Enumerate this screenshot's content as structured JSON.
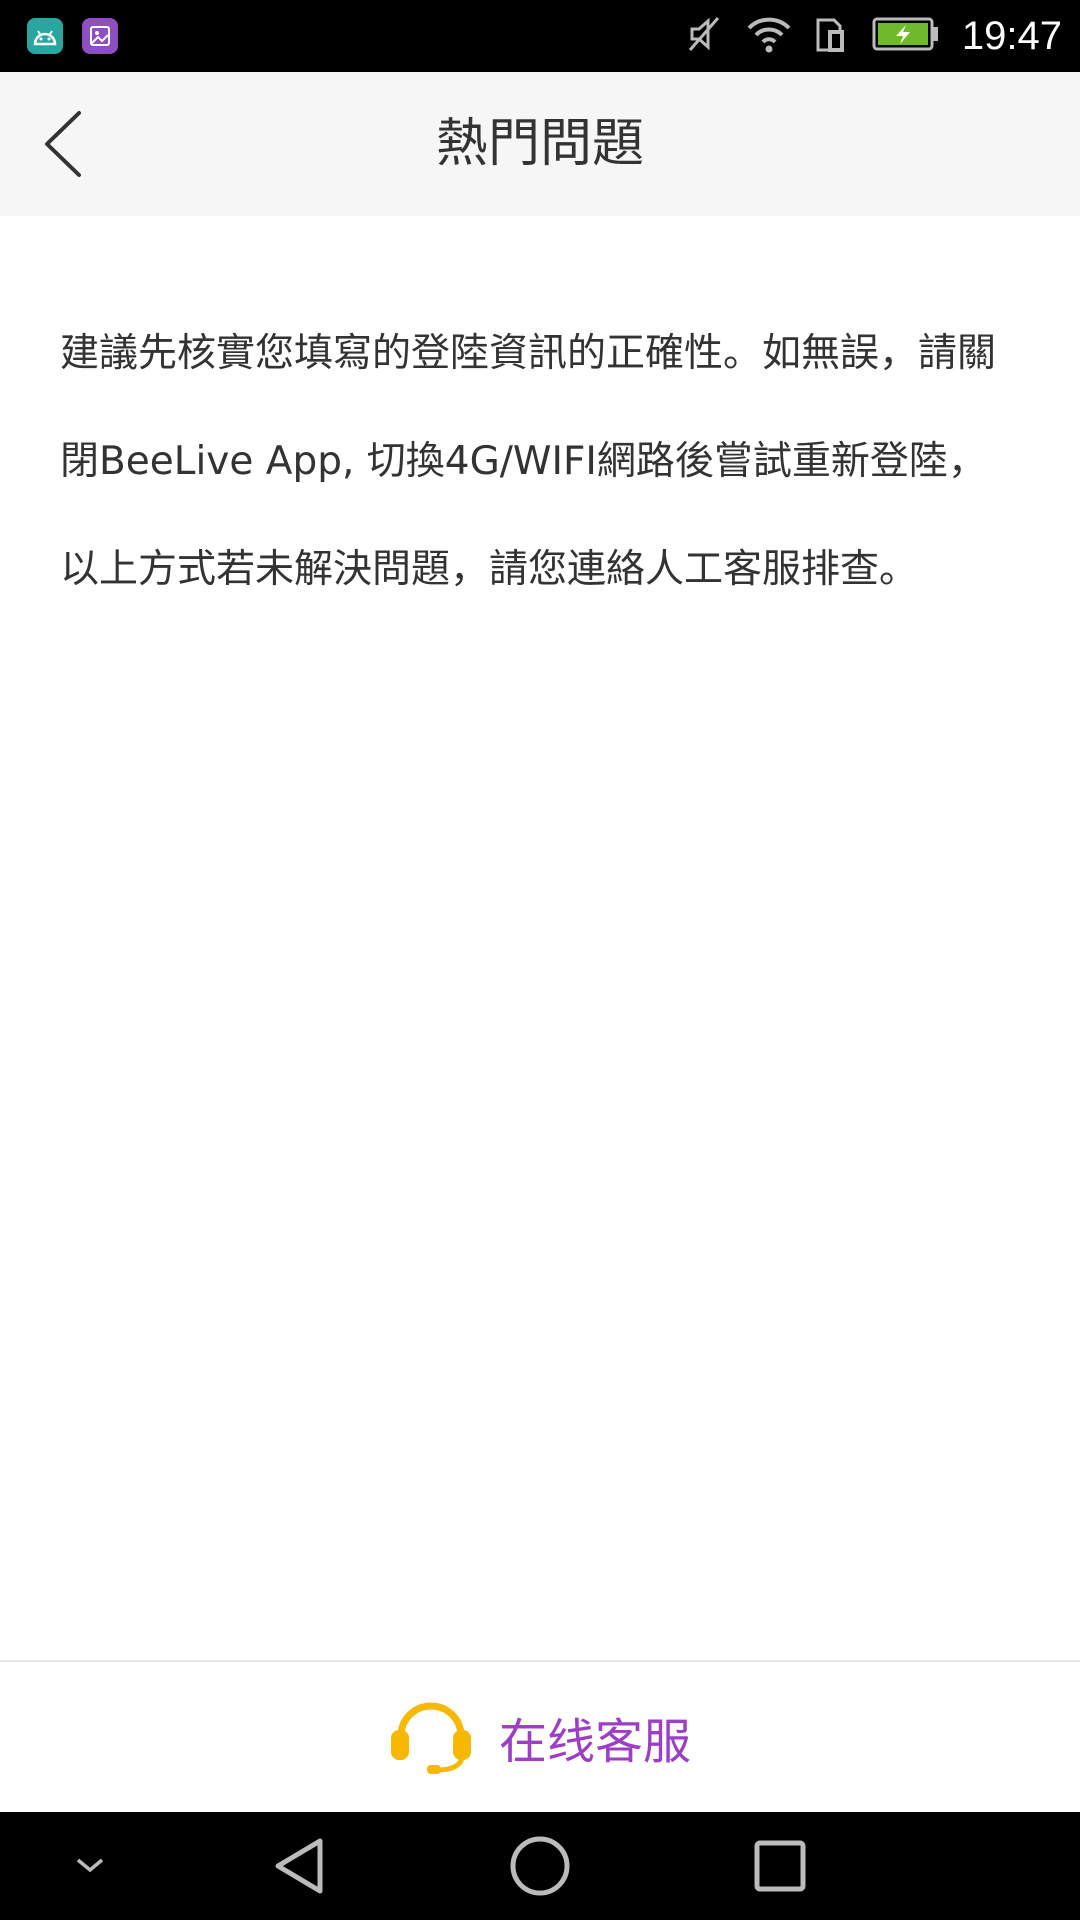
{
  "status_bar": {
    "time": "19:47",
    "icons": [
      "android-app-icon",
      "gallery-app-icon",
      "mute-icon",
      "wifi-icon",
      "sim-icon",
      "battery-charging-icon"
    ]
  },
  "header": {
    "title": "熱門問題",
    "back_icon": "chevron-left-icon"
  },
  "content": {
    "answer": "建議先核實您填寫的登陸資訊的正確性。如無誤，請關閉BeeLive App, 切換4G/WIFI網路後嘗試重新登陸，以上方式若未解決問題，請您連絡人工客服排查。"
  },
  "footer": {
    "service_label": "在线客服",
    "service_icon": "headset-icon"
  },
  "nav_bar": {
    "icons": [
      "collapse-icon",
      "back-triangle-icon",
      "home-circle-icon",
      "recents-square-icon"
    ]
  },
  "colors": {
    "accent_purple": "#9b3fc4",
    "headset_yellow": "#f6b800",
    "header_bg": "#f6f6f6"
  }
}
